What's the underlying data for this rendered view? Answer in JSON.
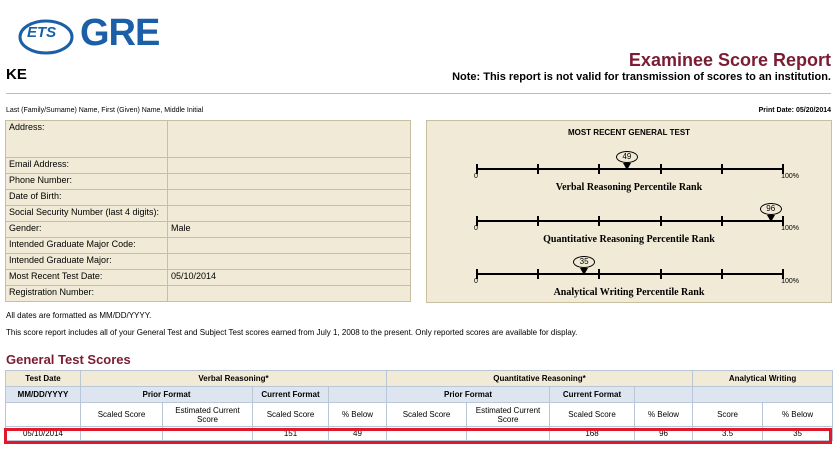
{
  "logo": {
    "ets": "ETS",
    "gre": "GRE"
  },
  "examinee": {
    "name": "KE",
    "name_label": "Last (Family/Surname) Name, First (Given) Name, Middle Initial"
  },
  "report": {
    "title": "Examinee Score Report",
    "note": "Note: This report is not valid for transmission of scores to an institution.",
    "print_date": "Print Date: 05/20/2014"
  },
  "info_rows": [
    {
      "label": "Address:",
      "value": ""
    },
    {
      "label": "Email Address:",
      "value": ""
    },
    {
      "label": "Phone Number:",
      "value": ""
    },
    {
      "label": "Date of Birth:",
      "value": ""
    },
    {
      "label": "Social Security Number (last 4 digits):",
      "value": ""
    },
    {
      "label": "Gender:",
      "value": "Male"
    },
    {
      "label": "Intended Graduate Major Code:",
      "value": ""
    },
    {
      "label": "Intended Graduate Major:",
      "value": ""
    },
    {
      "label": "Most Recent Test Date:",
      "value": "05/10/2014"
    },
    {
      "label": "Registration Number:",
      "value": ""
    }
  ],
  "percentiles": {
    "title": "MOST RECENT GENERAL TEST",
    "min_label": "0",
    "max_label": "100%",
    "scales": [
      {
        "label": "Verbal Reasoning Percentile Rank",
        "value": 49
      },
      {
        "label": "Quantitative Reasoning Percentile Rank",
        "value": 96
      },
      {
        "label": "Analytical Writing Percentile Rank",
        "value": 35
      }
    ]
  },
  "footnotes": {
    "dates": "All dates are formatted as MM/DD/YYYY.",
    "scores": "This score report includes all of your General Test and Subject Test scores earned from July 1, 2008 to the present. Only reported scores are available for display."
  },
  "scores": {
    "section_title": "General Test Scores",
    "h_test_date": "Test Date",
    "h_verbal": "Verbal Reasoning*",
    "h_quant": "Quantitative Reasoning*",
    "h_aw": "Analytical Writing",
    "h_date_fmt": "MM/DD/YYYY",
    "h_prior": "Prior Format",
    "h_current": "Current Format",
    "h_scaled": "Scaled Score",
    "h_estimated": "Estimated Current Score",
    "h_below": "% Below",
    "h_score": "Score",
    "row": {
      "date": "05/10/2014",
      "v_prior_scaled": "",
      "v_prior_est": "",
      "v_scaled": "151",
      "v_below": "49",
      "q_prior_scaled": "",
      "q_prior_est": "",
      "q_scaled": "168",
      "q_below": "96",
      "aw_score": "3.5",
      "aw_below": "35"
    }
  },
  "colors": {
    "brand_blue": "#1a5fa8",
    "title_maroon": "#7b1c33",
    "panel_bg": "#f0ead6",
    "highlight_red": "#e0182a"
  }
}
